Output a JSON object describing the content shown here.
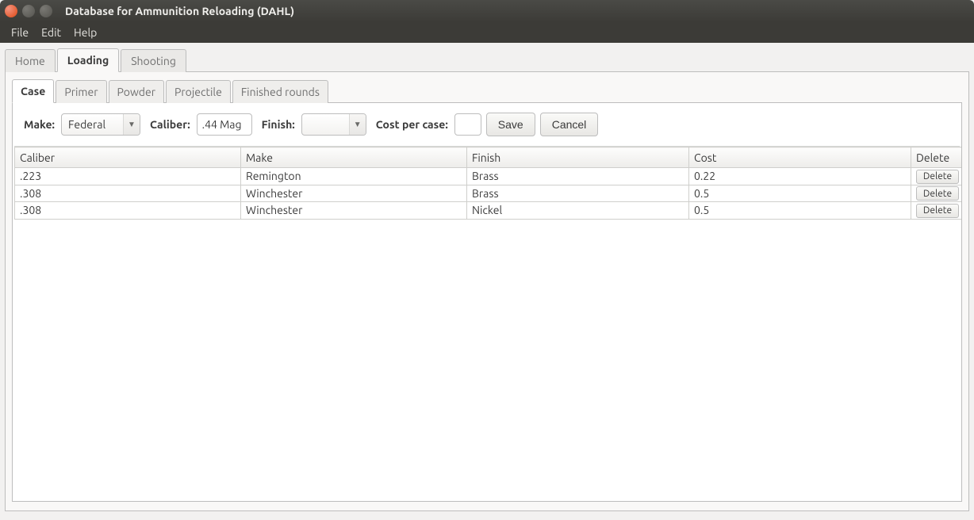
{
  "window": {
    "title": "Database for Ammunition Reloading (DAHL)"
  },
  "menubar": {
    "file": "File",
    "edit": "Edit",
    "help": "Help"
  },
  "main_tabs": {
    "home": "Home",
    "loading": "Loading",
    "shooting": "Shooting"
  },
  "sub_tabs": {
    "case": "Case",
    "primer": "Primer",
    "powder": "Powder",
    "projectile": "Projectile",
    "finished_rounds": "Finished rounds"
  },
  "form": {
    "make_label": "Make:",
    "make_value": "Federal",
    "caliber_label": "Caliber:",
    "caliber_value": ".44 Mag",
    "finish_label": "Finish:",
    "finish_value": "",
    "cost_label": "Cost per case:",
    "cost_value": "",
    "save_label": "Save",
    "cancel_label": "Cancel"
  },
  "table": {
    "headers": {
      "caliber": "Caliber",
      "make": "Make",
      "finish": "Finish",
      "cost": "Cost",
      "delete": "Delete"
    },
    "rows": [
      {
        "caliber": ".223",
        "make": "Remington",
        "finish": "Brass",
        "cost": "0.22",
        "delete": "Delete"
      },
      {
        "caliber": ".308",
        "make": "Winchester",
        "finish": "Brass",
        "cost": "0.5",
        "delete": "Delete"
      },
      {
        "caliber": ".308",
        "make": "Winchester",
        "finish": "Nickel",
        "cost": "0.5",
        "delete": "Delete"
      }
    ]
  }
}
